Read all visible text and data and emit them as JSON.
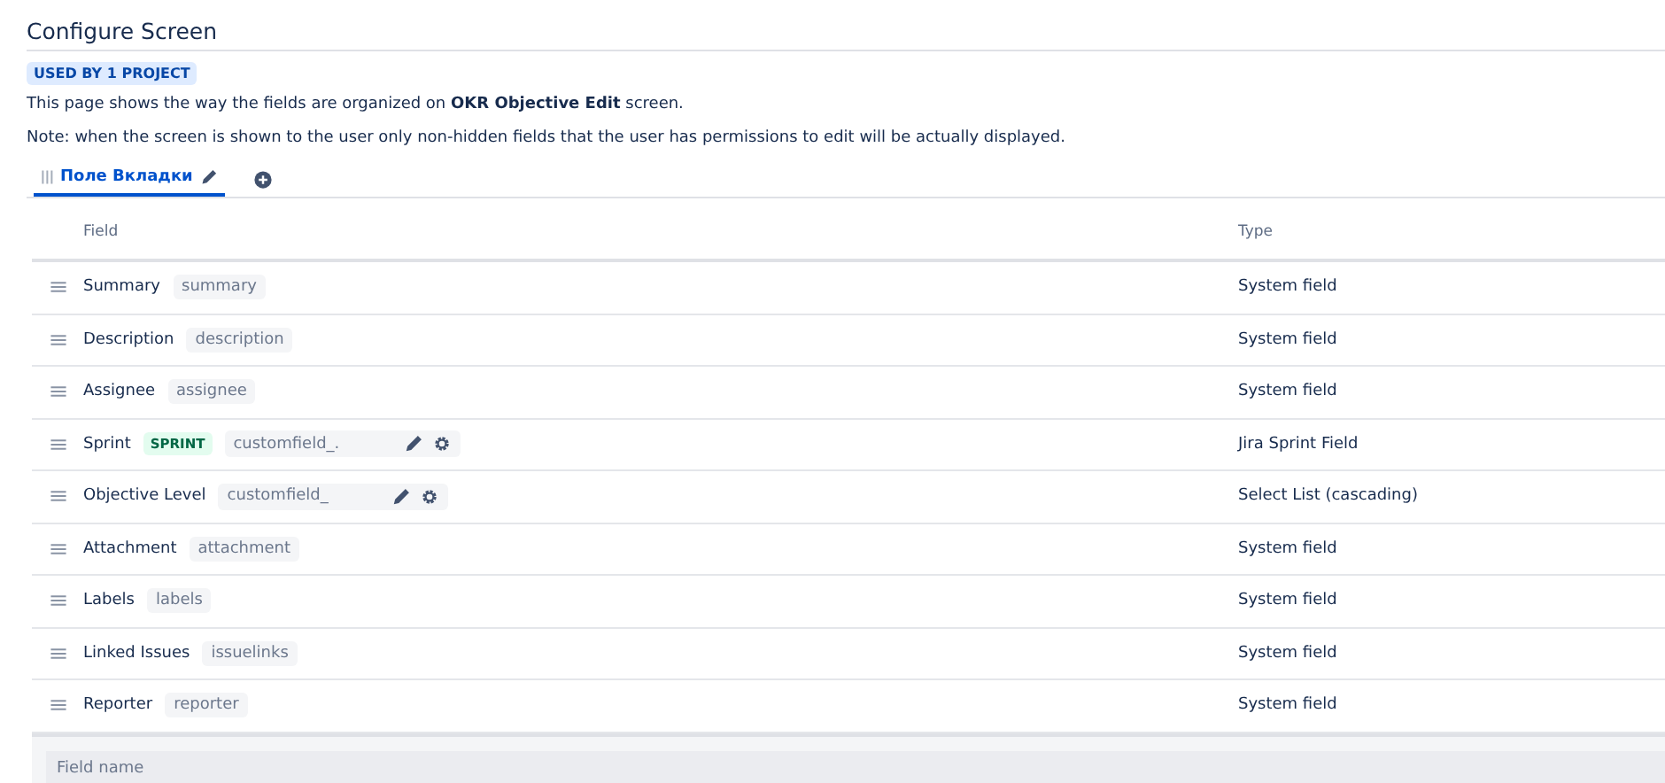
{
  "header": {
    "title": "Configure Screen",
    "lozenge": "USED BY 1 PROJECT"
  },
  "description": "This page shows the way the fields are organized on **OKR Objective Edit** screen.",
  "note": "Note: when the screen is shown to the user only non-hidden fields that the user has permissions to edit will be actually displayed.",
  "tabs": [
    {
      "label": "Поле Вкладки",
      "selected": true
    }
  ],
  "table": {
    "columns": [
      "Field",
      "Type"
    ],
    "rows": [
      {
        "kind": "system",
        "name": "Summary",
        "key": "summary",
        "type": "System field"
      },
      {
        "kind": "system",
        "name": "Description",
        "key": "description",
        "type": "System field"
      },
      {
        "kind": "system",
        "name": "Assignee",
        "key": "assignee",
        "type": "System field"
      },
      {
        "kind": "custom",
        "name": "Sprint",
        "lozenge": "SPRINT",
        "key": "customfield_.",
        "type": "Jira Sprint Field"
      },
      {
        "kind": "custom",
        "name": "Objective Level",
        "key": "customfield_",
        "type": "Select List (cascading)"
      },
      {
        "kind": "system",
        "name": "Attachment",
        "key": "attachment",
        "type": "System field"
      },
      {
        "kind": "system",
        "name": "Labels",
        "key": "labels",
        "type": "System field"
      },
      {
        "kind": "system",
        "name": "Linked Issues",
        "key": "issuelinks",
        "type": "System field"
      },
      {
        "kind": "system",
        "name": "Reporter",
        "key": "reporter",
        "type": "System field"
      }
    ]
  },
  "add_field": {
    "placeholder": "Field name"
  }
}
